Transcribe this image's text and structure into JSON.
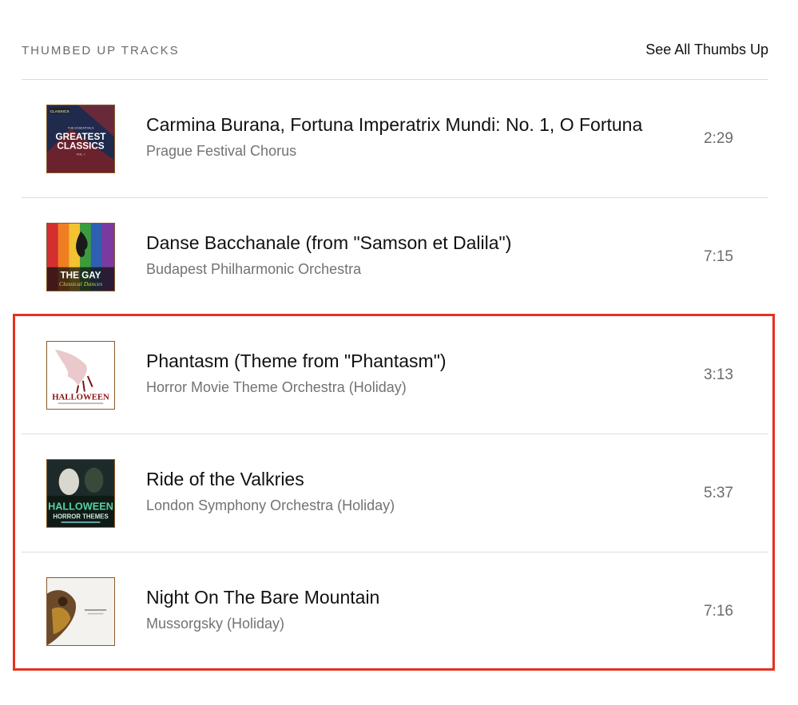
{
  "header": {
    "title": "THUMBED UP TRACKS",
    "see_all": "See All Thumbs Up"
  },
  "tracks": [
    {
      "title": "Carmina Burana, Fortuna Imperatrix Mundi: No. 1, O Fortuna",
      "artist": "Prague Festival Chorus",
      "duration": "2:29",
      "art_text": {
        "top": "CLASSICS",
        "line1": "THE ESSENTIALS",
        "line2": "GREATEST",
        "line3": "CLASSICS",
        "line4": "VOL. I"
      }
    },
    {
      "title": "Danse Bacchanale (from \"Samson et Dalila\")",
      "artist": "Budapest Philharmonic Orchestra",
      "duration": "7:15",
      "art_text": {
        "line1": "THE GAY",
        "line2": "Classical Dances"
      }
    },
    {
      "title": "Phantasm (Theme from \"Phantasm\")",
      "artist": "Horror Movie Theme Orchestra (Holiday)",
      "duration": "3:13",
      "art_text": {
        "line1": "HALLOWEEN"
      }
    },
    {
      "title": "Ride of the Valkries",
      "artist": "London Symphony Orchestra (Holiday)",
      "duration": "5:37",
      "art_text": {
        "line1": "HALLOWEEN",
        "line2": "HORROR THEMES"
      }
    },
    {
      "title": "Night On The Bare Mountain",
      "artist": "Mussorgsky (Holiday)",
      "duration": "7:16",
      "art_text": {}
    }
  ],
  "colors": {
    "highlight": "#e5321f",
    "divider": "#dcdcdc",
    "muted_text": "#737373"
  }
}
